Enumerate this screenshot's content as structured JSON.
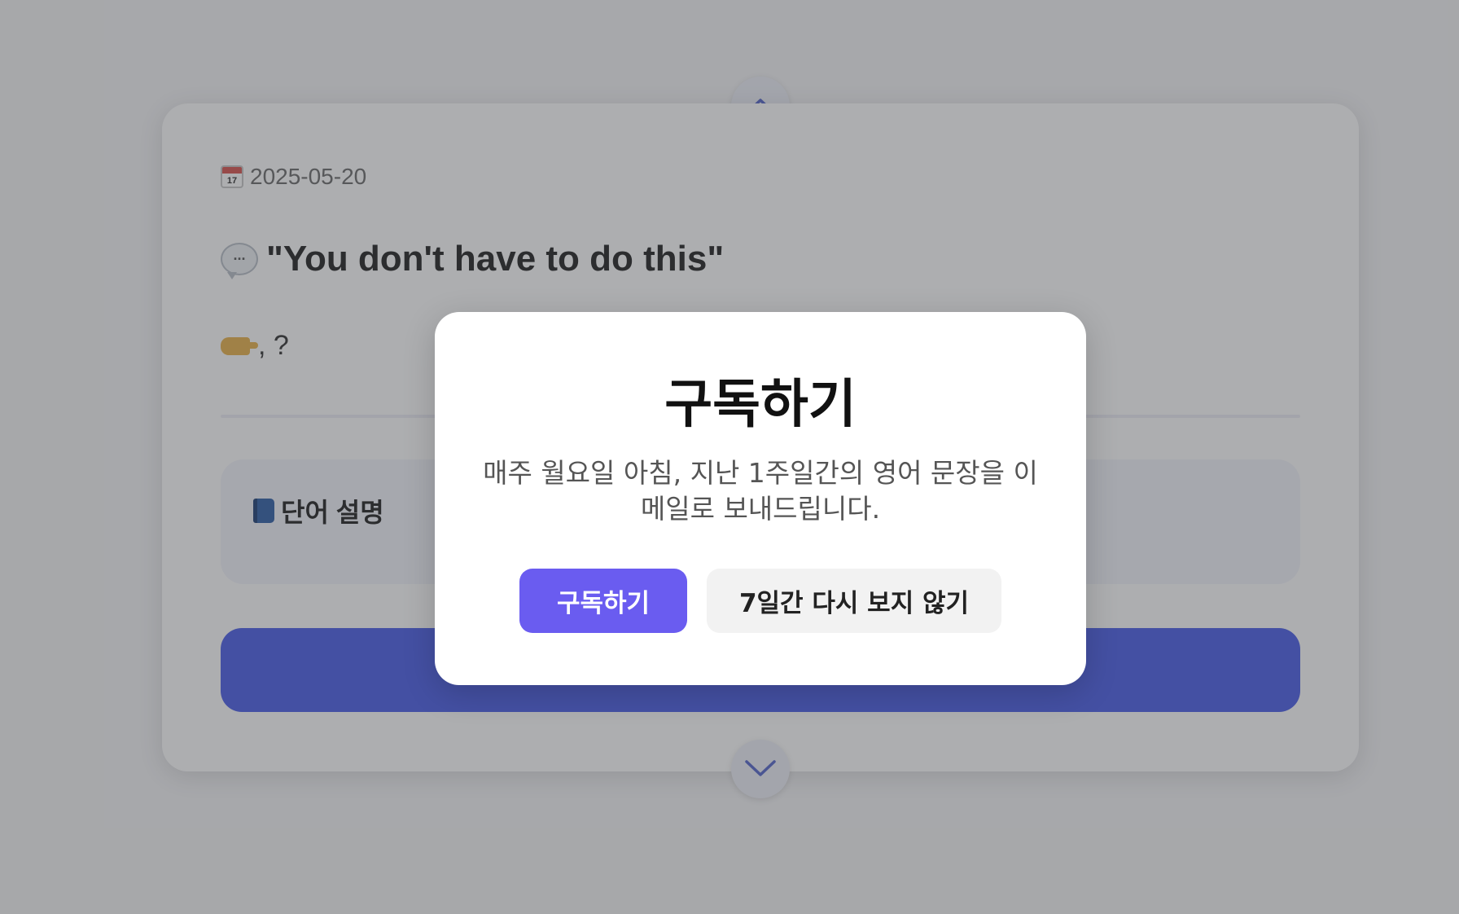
{
  "card": {
    "date": "2025-05-20",
    "date_icon_day": "17",
    "sentence": "\"You don't have to do this\"",
    "hint": ", ?",
    "word_section_title": "단어 설명"
  },
  "nav": {
    "up_icon": "chevron-up-icon",
    "down_icon": "chevron-down-icon"
  },
  "modal": {
    "title": "구독하기",
    "description": "매주 월요일 아침, 지난 1주일간의 영어 문장을 이메일로 보내드립니다.",
    "subscribe_label": "구독하기",
    "dismiss_label": "7일간 다시 보지 않기"
  },
  "colors": {
    "primary": "#4a5ee8",
    "subscribe_button": "#6a5cf0",
    "overlay": "rgba(60,62,66,0.42)"
  }
}
